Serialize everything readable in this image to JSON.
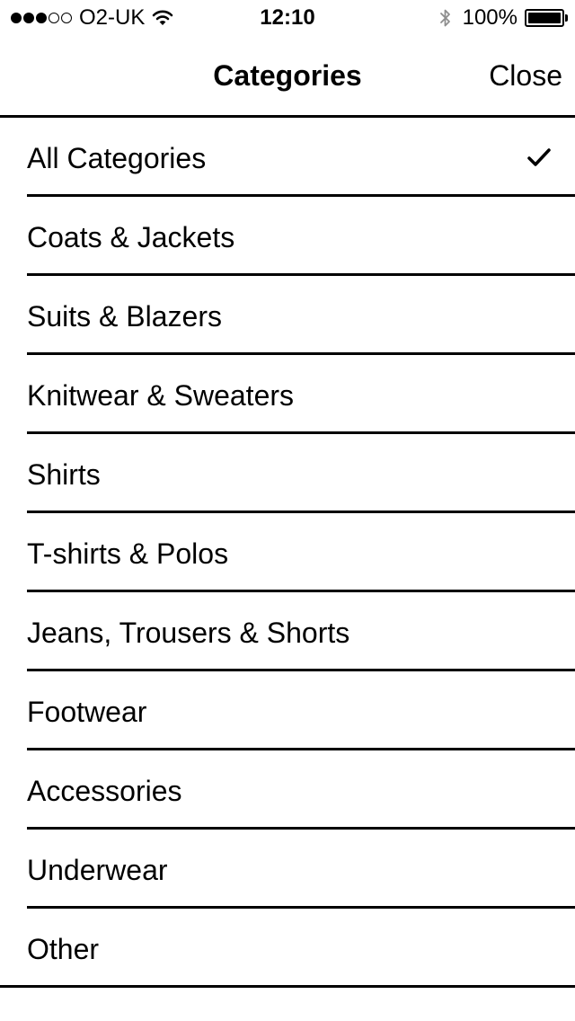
{
  "status_bar": {
    "carrier": "O2-UK",
    "signal_bars_filled": 3,
    "signal_bars_total": 5,
    "time": "12:10",
    "battery_percent": "100%",
    "icons": [
      "wifi-icon",
      "bluetooth-icon",
      "battery-icon"
    ]
  },
  "nav": {
    "title": "Categories",
    "close_label": "Close"
  },
  "categories": [
    {
      "label": "All Categories",
      "selected": true
    },
    {
      "label": "Coats & Jackets",
      "selected": false
    },
    {
      "label": "Suits & Blazers",
      "selected": false
    },
    {
      "label": "Knitwear & Sweaters",
      "selected": false
    },
    {
      "label": "Shirts",
      "selected": false
    },
    {
      "label": "T-shirts & Polos",
      "selected": false
    },
    {
      "label": "Jeans, Trousers & Shorts",
      "selected": false
    },
    {
      "label": "Footwear",
      "selected": false
    },
    {
      "label": "Accessories",
      "selected": false
    },
    {
      "label": "Underwear",
      "selected": false
    },
    {
      "label": "Other",
      "selected": false
    }
  ],
  "selected_icon": "checkmark-icon"
}
